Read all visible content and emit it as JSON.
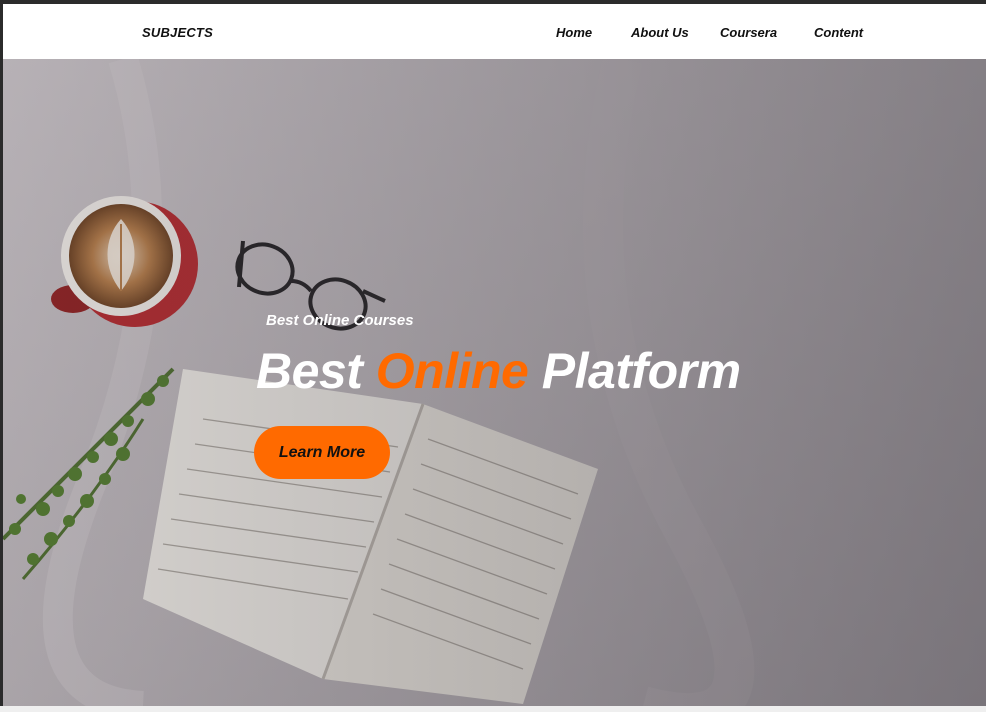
{
  "navbar": {
    "brand": "SUBJECTS",
    "links": [
      "Home",
      "About Us",
      "Coursera",
      "Content"
    ]
  },
  "hero": {
    "eyebrow": "Best Online Courses",
    "headline": {
      "part1": "Best",
      "accent": "Online",
      "part2": "Platform"
    },
    "cta_label": "Learn More"
  },
  "colors": {
    "accent": "#ff6a00",
    "text_dark": "#111111",
    "text_light": "#ffffff"
  },
  "icons": [
    "coffee-cup-image",
    "eyeglasses-image",
    "open-book-image",
    "plant-sprig-image"
  ]
}
